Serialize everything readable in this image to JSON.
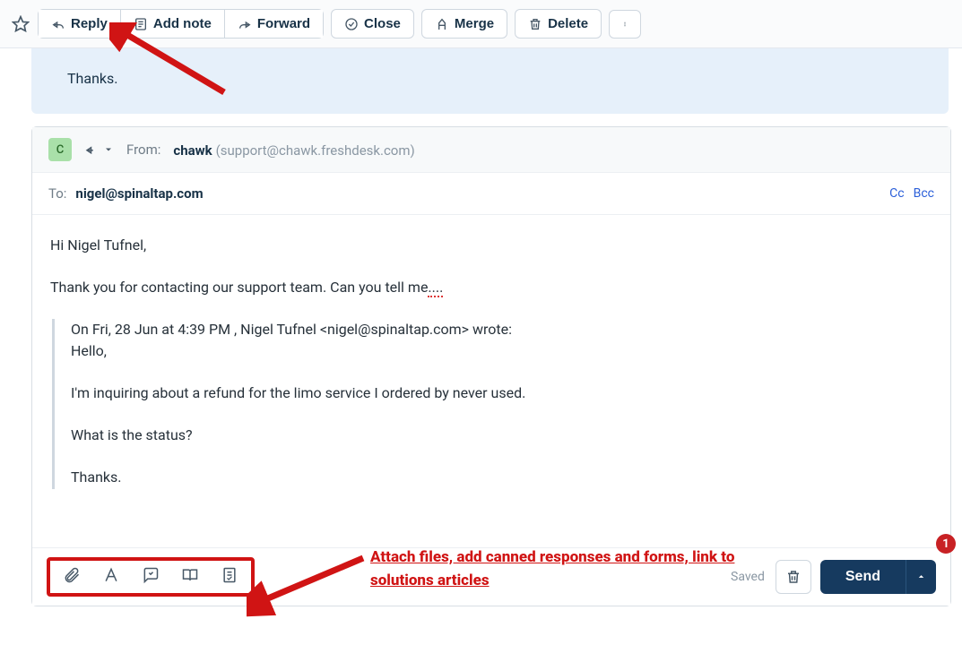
{
  "toolbar": {
    "reply": "Reply",
    "addnote": "Add note",
    "forward": "Forward",
    "close": "Close",
    "merge": "Merge",
    "delete": "Delete"
  },
  "prev_msg": "Thanks.",
  "composer": {
    "avatar_initial": "C",
    "from_label": "From:",
    "from_name": "chawk",
    "from_email": "(support@chawk.freshdesk.com)",
    "to_label": "To:",
    "to_value": "nigel@spinaltap.com",
    "cc": "Cc",
    "bcc": "Bcc",
    "body": {
      "greeting": "Hi Nigel Tufnel,",
      "line2a": "Thank you for contacting our support team.  Can you tell me",
      "line2b": "....",
      "quote_header": "On Fri, 28 Jun at 4:39 PM , Nigel Tufnel <nigel@spinaltap.com> wrote:",
      "quote_hello": "Hello,",
      "quote_inquiry": "I'm inquiring about a refund for the limo service I ordered by never used.",
      "quote_status": "What is the status?",
      "quote_thanks": "Thanks."
    },
    "footer": {
      "saved": "Saved",
      "send": "Send"
    }
  },
  "annotation": {
    "text": "Attach files, add canned responses and forms, link to solutions articles",
    "badge": "1"
  }
}
